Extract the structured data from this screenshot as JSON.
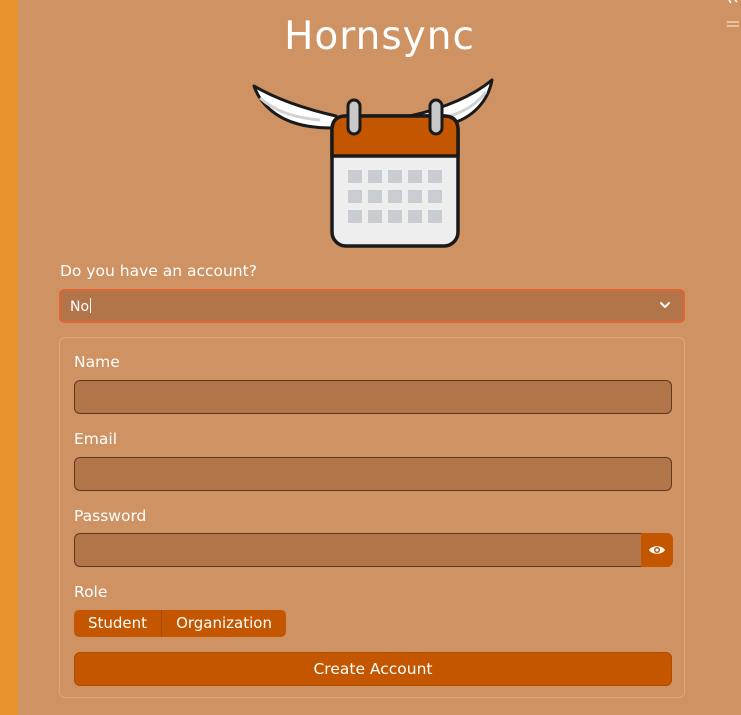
{
  "app": {
    "title": "Hornsync"
  },
  "account": {
    "question": "Do you have an account?",
    "selected": "No"
  },
  "form": {
    "name_label": "Name",
    "email_label": "Email",
    "password_label": "Password",
    "role_label": "Role",
    "roles": [
      "Student",
      "Organization"
    ],
    "submit_label": "Create Account"
  },
  "colors": {
    "background": "#e8922e",
    "panel": "#cf9262",
    "field": "#b27449",
    "accent": "#c45600",
    "focus_border": "#e36434"
  },
  "icons": {
    "logo": "bull-horn-calendar-logo",
    "select": "chevron-down-icon",
    "password_toggle": "eye-icon"
  }
}
